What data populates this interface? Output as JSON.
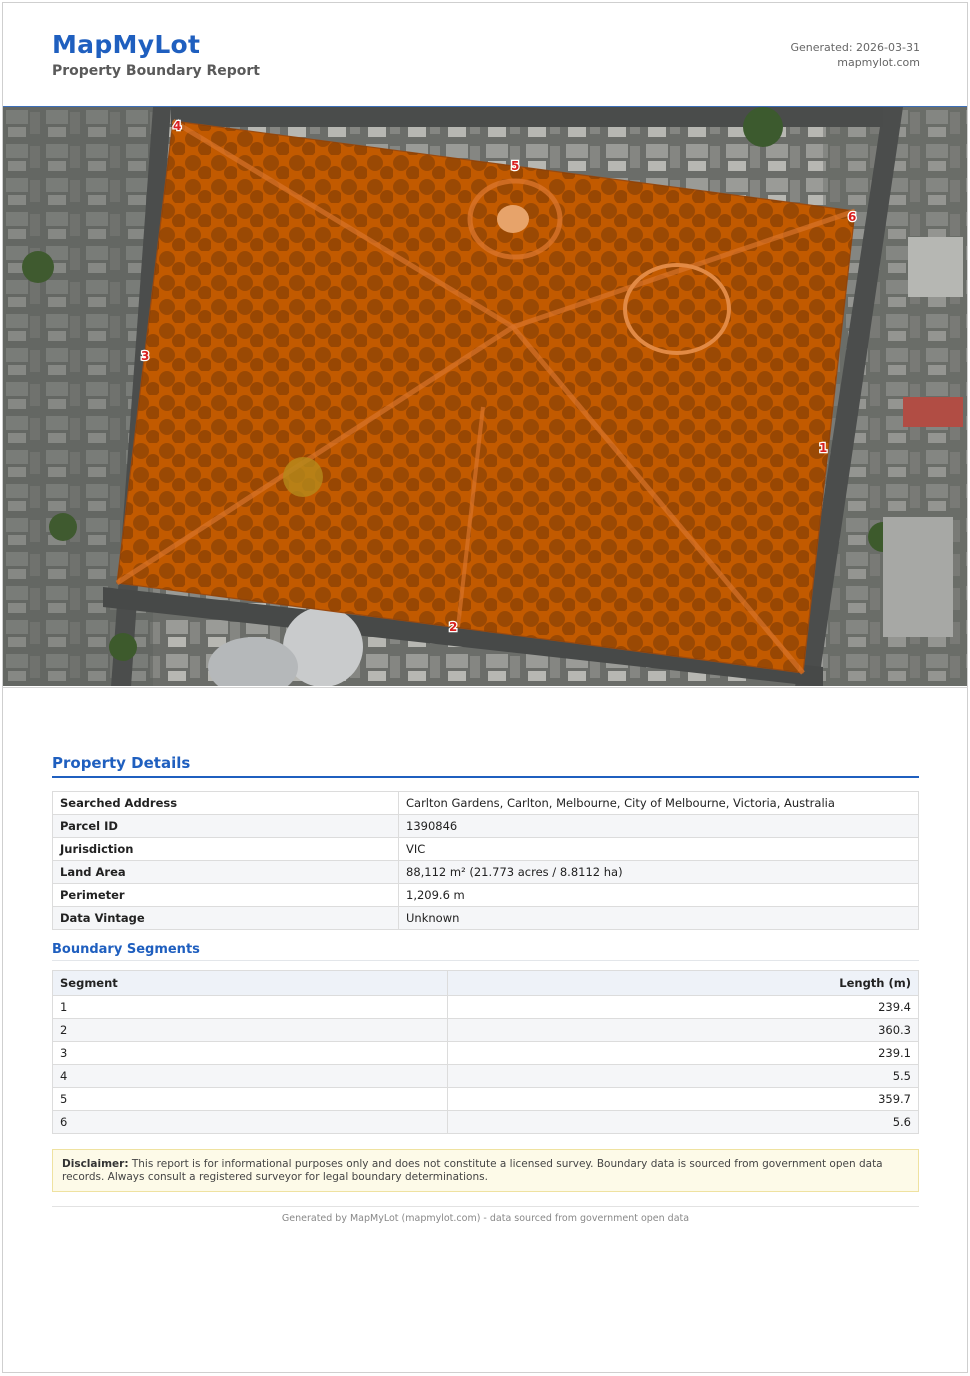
{
  "header": {
    "brand": "MapMyLot",
    "subtitle": "Property Boundary Report",
    "generated": "Generated: 2026-03-31",
    "site": "mapmylot.com"
  },
  "map": {
    "vertex_labels": [
      "1",
      "2",
      "3",
      "4",
      "5",
      "6"
    ],
    "boundary_fill_color": "#c25a00",
    "vertex_label_color": "#d92020"
  },
  "details": {
    "title": "Property Details",
    "rows": [
      {
        "key": "Searched Address",
        "value": "Carlton Gardens, Carlton, Melbourne, City of Melbourne, Victoria, Australia"
      },
      {
        "key": "Parcel ID",
        "value": "1390846"
      },
      {
        "key": "Jurisdiction",
        "value": "VIC"
      },
      {
        "key": "Land Area",
        "value": "88,112 m² (21.773 acres / 8.8112 ha)"
      },
      {
        "key": "Perimeter",
        "value": "1,209.6 m"
      },
      {
        "key": "Data Vintage",
        "value": "Unknown"
      }
    ]
  },
  "segments": {
    "title": "Boundary Segments",
    "col_segment": "Segment",
    "col_length": "Length (m)",
    "rows": [
      {
        "segment": "1",
        "length": "239.4"
      },
      {
        "segment": "2",
        "length": "360.3"
      },
      {
        "segment": "3",
        "length": "239.1"
      },
      {
        "segment": "4",
        "length": "5.5"
      },
      {
        "segment": "5",
        "length": "359.7"
      },
      {
        "segment": "6",
        "length": "5.6"
      }
    ]
  },
  "disclaimer": {
    "label": "Disclaimer:",
    "text": " This report is for informational purposes only and does not constitute a licensed survey. Boundary data is sourced from government open data records. Always consult a registered surveyor for legal boundary determinations."
  },
  "footer": {
    "text": "Generated by MapMyLot (mapmylot.com) - data sourced from government open data"
  },
  "colors": {
    "brand_blue": "#1f5fbf",
    "disclaimer_bg": "#fdfae8"
  }
}
